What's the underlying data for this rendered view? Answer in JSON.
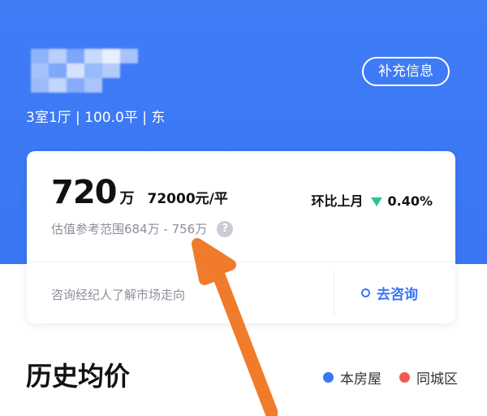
{
  "header": {
    "supplement_button": "补充信息",
    "house_info": "3室1厅 | 100.0平 | 东"
  },
  "valuation": {
    "price": "720",
    "price_unit": "万",
    "unit_price": "72000元/平",
    "mom_label": "环比上月",
    "mom_value": "0.40%",
    "range_text": "估值参考范围684万 - 756万",
    "help_glyph": "?"
  },
  "consult": {
    "prompt": "咨询经纪人了解市场走向",
    "button_label": "去咨询"
  },
  "history": {
    "title": "历史均价",
    "legend": [
      {
        "label": "本房屋",
        "color": "#3a76f3"
      },
      {
        "label": "同城区",
        "color": "#f05a4f"
      }
    ]
  },
  "colors": {
    "hero_bg": "#3f7cf6",
    "accent": "#3a76f3",
    "down": "#2ec295",
    "arrow": "#f07b2a"
  }
}
